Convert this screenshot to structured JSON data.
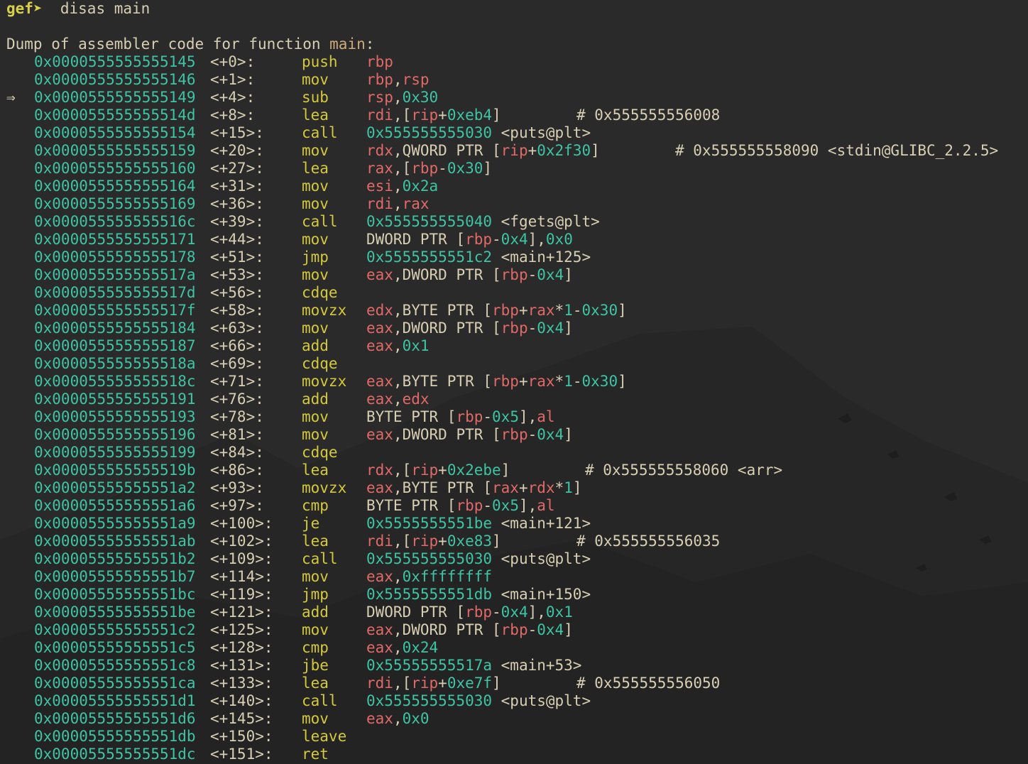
{
  "prompt": {
    "symbol": "gef➤",
    "command": "disas main"
  },
  "dump": {
    "prefix": "Dump of assembler code for function ",
    "function": "main",
    "suffix": ":"
  },
  "current_marker": "⇒",
  "instructions": [
    {
      "addr": "0x0000555555555145",
      "offset": "<+0>:",
      "mnemonic": "push",
      "ops": [
        {
          "t": "rbp",
          "k": "reg"
        }
      ]
    },
    {
      "addr": "0x0000555555555146",
      "offset": "<+1>:",
      "mnemonic": "mov",
      "ops": [
        {
          "t": "rbp",
          "k": "reg"
        },
        {
          "t": ",",
          "k": "txt"
        },
        {
          "t": "rsp",
          "k": "reg"
        }
      ]
    },
    {
      "addr": "0x0000555555555149",
      "offset": "<+4>:",
      "mnemonic": "sub",
      "current": true,
      "ops": [
        {
          "t": "rsp",
          "k": "reg"
        },
        {
          "t": ",",
          "k": "txt"
        },
        {
          "t": "0x30",
          "k": "num"
        }
      ]
    },
    {
      "addr": "0x000055555555514d",
      "offset": "<+8>:",
      "mnemonic": "lea",
      "ops": [
        {
          "t": "rdi",
          "k": "reg"
        },
        {
          "t": ",[",
          "k": "txt"
        },
        {
          "t": "rip",
          "k": "reg"
        },
        {
          "t": "+",
          "k": "txt"
        },
        {
          "t": "0xeb4",
          "k": "num"
        },
        {
          "t": "]",
          "k": "txt"
        }
      ],
      "comment": "# 0x555555556008"
    },
    {
      "addr": "0x0000555555555154",
      "offset": "<+15>:",
      "mnemonic": "call",
      "ops": [
        {
          "t": "0x555555555030",
          "k": "num"
        },
        {
          "t": " <puts@plt>",
          "k": "sym"
        }
      ]
    },
    {
      "addr": "0x0000555555555159",
      "offset": "<+20>:",
      "mnemonic": "mov",
      "ops": [
        {
          "t": "rdx",
          "k": "reg"
        },
        {
          "t": ",QWORD PTR [",
          "k": "txt"
        },
        {
          "t": "rip",
          "k": "reg"
        },
        {
          "t": "+",
          "k": "txt"
        },
        {
          "t": "0x2f30",
          "k": "num"
        },
        {
          "t": "]",
          "k": "txt"
        }
      ],
      "comment": "# 0x555555558090 <stdin@GLIBC_2.2.5>"
    },
    {
      "addr": "0x0000555555555160",
      "offset": "<+27>:",
      "mnemonic": "lea",
      "ops": [
        {
          "t": "rax",
          "k": "reg"
        },
        {
          "t": ",[",
          "k": "txt"
        },
        {
          "t": "rbp",
          "k": "reg"
        },
        {
          "t": "-",
          "k": "txt"
        },
        {
          "t": "0x30",
          "k": "num"
        },
        {
          "t": "]",
          "k": "txt"
        }
      ]
    },
    {
      "addr": "0x0000555555555164",
      "offset": "<+31>:",
      "mnemonic": "mov",
      "ops": [
        {
          "t": "esi",
          "k": "reg"
        },
        {
          "t": ",",
          "k": "txt"
        },
        {
          "t": "0x2a",
          "k": "num"
        }
      ]
    },
    {
      "addr": "0x0000555555555169",
      "offset": "<+36>:",
      "mnemonic": "mov",
      "ops": [
        {
          "t": "rdi",
          "k": "reg"
        },
        {
          "t": ",",
          "k": "txt"
        },
        {
          "t": "rax",
          "k": "reg"
        }
      ]
    },
    {
      "addr": "0x000055555555516c",
      "offset": "<+39>:",
      "mnemonic": "call",
      "ops": [
        {
          "t": "0x555555555040",
          "k": "num"
        },
        {
          "t": " <fgets@plt>",
          "k": "sym"
        }
      ]
    },
    {
      "addr": "0x0000555555555171",
      "offset": "<+44>:",
      "mnemonic": "mov",
      "ops": [
        {
          "t": "DWORD PTR [",
          "k": "txt"
        },
        {
          "t": "rbp",
          "k": "reg"
        },
        {
          "t": "-",
          "k": "txt"
        },
        {
          "t": "0x4",
          "k": "num"
        },
        {
          "t": "],",
          "k": "txt"
        },
        {
          "t": "0x0",
          "k": "num"
        }
      ]
    },
    {
      "addr": "0x0000555555555178",
      "offset": "<+51>:",
      "mnemonic": "jmp",
      "ops": [
        {
          "t": "0x5555555551c2",
          "k": "num"
        },
        {
          "t": " <main+125>",
          "k": "sym"
        }
      ]
    },
    {
      "addr": "0x000055555555517a",
      "offset": "<+53>:",
      "mnemonic": "mov",
      "ops": [
        {
          "t": "eax",
          "k": "reg"
        },
        {
          "t": ",DWORD PTR [",
          "k": "txt"
        },
        {
          "t": "rbp",
          "k": "reg"
        },
        {
          "t": "-",
          "k": "txt"
        },
        {
          "t": "0x4",
          "k": "num"
        },
        {
          "t": "]",
          "k": "txt"
        }
      ]
    },
    {
      "addr": "0x000055555555517d",
      "offset": "<+56>:",
      "mnemonic": "cdqe",
      "ops": []
    },
    {
      "addr": "0x000055555555517f",
      "offset": "<+58>:",
      "mnemonic": "movzx",
      "ops": [
        {
          "t": "edx",
          "k": "reg"
        },
        {
          "t": ",BYTE PTR [",
          "k": "txt"
        },
        {
          "t": "rbp",
          "k": "reg"
        },
        {
          "t": "+",
          "k": "txt"
        },
        {
          "t": "rax",
          "k": "reg"
        },
        {
          "t": "*",
          "k": "txt"
        },
        {
          "t": "1",
          "k": "num"
        },
        {
          "t": "-",
          "k": "txt"
        },
        {
          "t": "0x30",
          "k": "num"
        },
        {
          "t": "]",
          "k": "txt"
        }
      ]
    },
    {
      "addr": "0x0000555555555184",
      "offset": "<+63>:",
      "mnemonic": "mov",
      "ops": [
        {
          "t": "eax",
          "k": "reg"
        },
        {
          "t": ",DWORD PTR [",
          "k": "txt"
        },
        {
          "t": "rbp",
          "k": "reg"
        },
        {
          "t": "-",
          "k": "txt"
        },
        {
          "t": "0x4",
          "k": "num"
        },
        {
          "t": "]",
          "k": "txt"
        }
      ]
    },
    {
      "addr": "0x0000555555555187",
      "offset": "<+66>:",
      "mnemonic": "add",
      "ops": [
        {
          "t": "eax",
          "k": "reg"
        },
        {
          "t": ",",
          "k": "txt"
        },
        {
          "t": "0x1",
          "k": "num"
        }
      ]
    },
    {
      "addr": "0x000055555555518a",
      "offset": "<+69>:",
      "mnemonic": "cdqe",
      "ops": []
    },
    {
      "addr": "0x000055555555518c",
      "offset": "<+71>:",
      "mnemonic": "movzx",
      "ops": [
        {
          "t": "eax",
          "k": "reg"
        },
        {
          "t": ",BYTE PTR [",
          "k": "txt"
        },
        {
          "t": "rbp",
          "k": "reg"
        },
        {
          "t": "+",
          "k": "txt"
        },
        {
          "t": "rax",
          "k": "reg"
        },
        {
          "t": "*",
          "k": "txt"
        },
        {
          "t": "1",
          "k": "num"
        },
        {
          "t": "-",
          "k": "txt"
        },
        {
          "t": "0x30",
          "k": "num"
        },
        {
          "t": "]",
          "k": "txt"
        }
      ]
    },
    {
      "addr": "0x0000555555555191",
      "offset": "<+76>:",
      "mnemonic": "add",
      "ops": [
        {
          "t": "eax",
          "k": "reg"
        },
        {
          "t": ",",
          "k": "txt"
        },
        {
          "t": "edx",
          "k": "reg"
        }
      ]
    },
    {
      "addr": "0x0000555555555193",
      "offset": "<+78>:",
      "mnemonic": "mov",
      "ops": [
        {
          "t": "BYTE PTR [",
          "k": "txt"
        },
        {
          "t": "rbp",
          "k": "reg"
        },
        {
          "t": "-",
          "k": "txt"
        },
        {
          "t": "0x5",
          "k": "num"
        },
        {
          "t": "],",
          "k": "txt"
        },
        {
          "t": "al",
          "k": "reg"
        }
      ]
    },
    {
      "addr": "0x0000555555555196",
      "offset": "<+81>:",
      "mnemonic": "mov",
      "ops": [
        {
          "t": "eax",
          "k": "reg"
        },
        {
          "t": ",DWORD PTR [",
          "k": "txt"
        },
        {
          "t": "rbp",
          "k": "reg"
        },
        {
          "t": "-",
          "k": "txt"
        },
        {
          "t": "0x4",
          "k": "num"
        },
        {
          "t": "]",
          "k": "txt"
        }
      ]
    },
    {
      "addr": "0x0000555555555199",
      "offset": "<+84>:",
      "mnemonic": "cdqe",
      "ops": []
    },
    {
      "addr": "0x000055555555519b",
      "offset": "<+86>:",
      "mnemonic": "lea",
      "ops": [
        {
          "t": "rdx",
          "k": "reg"
        },
        {
          "t": ",[",
          "k": "txt"
        },
        {
          "t": "rip",
          "k": "reg"
        },
        {
          "t": "+",
          "k": "txt"
        },
        {
          "t": "0x2ebe",
          "k": "num"
        },
        {
          "t": "]",
          "k": "txt"
        }
      ],
      "comment": "# 0x555555558060 <arr>"
    },
    {
      "addr": "0x00005555555551a2",
      "offset": "<+93>:",
      "mnemonic": "movzx",
      "ops": [
        {
          "t": "eax",
          "k": "reg"
        },
        {
          "t": ",BYTE PTR [",
          "k": "txt"
        },
        {
          "t": "rax",
          "k": "reg"
        },
        {
          "t": "+",
          "k": "txt"
        },
        {
          "t": "rdx",
          "k": "reg"
        },
        {
          "t": "*",
          "k": "txt"
        },
        {
          "t": "1",
          "k": "num"
        },
        {
          "t": "]",
          "k": "txt"
        }
      ]
    },
    {
      "addr": "0x00005555555551a6",
      "offset": "<+97>:",
      "mnemonic": "cmp",
      "ops": [
        {
          "t": "BYTE PTR [",
          "k": "txt"
        },
        {
          "t": "rbp",
          "k": "reg"
        },
        {
          "t": "-",
          "k": "txt"
        },
        {
          "t": "0x5",
          "k": "num"
        },
        {
          "t": "],",
          "k": "txt"
        },
        {
          "t": "al",
          "k": "reg"
        }
      ]
    },
    {
      "addr": "0x00005555555551a9",
      "offset": "<+100>:",
      "mnemonic": "je",
      "ops": [
        {
          "t": "0x5555555551be",
          "k": "num"
        },
        {
          "t": " <main+121>",
          "k": "sym"
        }
      ]
    },
    {
      "addr": "0x00005555555551ab",
      "offset": "<+102>:",
      "mnemonic": "lea",
      "ops": [
        {
          "t": "rdi",
          "k": "reg"
        },
        {
          "t": ",[",
          "k": "txt"
        },
        {
          "t": "rip",
          "k": "reg"
        },
        {
          "t": "+",
          "k": "txt"
        },
        {
          "t": "0xe83",
          "k": "num"
        },
        {
          "t": "]",
          "k": "txt"
        }
      ],
      "comment": "# 0x555555556035"
    },
    {
      "addr": "0x00005555555551b2",
      "offset": "<+109>:",
      "mnemonic": "call",
      "ops": [
        {
          "t": "0x555555555030",
          "k": "num"
        },
        {
          "t": " <puts@plt>",
          "k": "sym"
        }
      ]
    },
    {
      "addr": "0x00005555555551b7",
      "offset": "<+114>:",
      "mnemonic": "mov",
      "ops": [
        {
          "t": "eax",
          "k": "reg"
        },
        {
          "t": ",",
          "k": "txt"
        },
        {
          "t": "0xffffffff",
          "k": "num"
        }
      ]
    },
    {
      "addr": "0x00005555555551bc",
      "offset": "<+119>:",
      "mnemonic": "jmp",
      "ops": [
        {
          "t": "0x5555555551db",
          "k": "num"
        },
        {
          "t": " <main+150>",
          "k": "sym"
        }
      ]
    },
    {
      "addr": "0x00005555555551be",
      "offset": "<+121>:",
      "mnemonic": "add",
      "ops": [
        {
          "t": "DWORD PTR [",
          "k": "txt"
        },
        {
          "t": "rbp",
          "k": "reg"
        },
        {
          "t": "-",
          "k": "txt"
        },
        {
          "t": "0x4",
          "k": "num"
        },
        {
          "t": "],",
          "k": "txt"
        },
        {
          "t": "0x1",
          "k": "num"
        }
      ]
    },
    {
      "addr": "0x00005555555551c2",
      "offset": "<+125>:",
      "mnemonic": "mov",
      "ops": [
        {
          "t": "eax",
          "k": "reg"
        },
        {
          "t": ",DWORD PTR [",
          "k": "txt"
        },
        {
          "t": "rbp",
          "k": "reg"
        },
        {
          "t": "-",
          "k": "txt"
        },
        {
          "t": "0x4",
          "k": "num"
        },
        {
          "t": "]",
          "k": "txt"
        }
      ]
    },
    {
      "addr": "0x00005555555551c5",
      "offset": "<+128>:",
      "mnemonic": "cmp",
      "ops": [
        {
          "t": "eax",
          "k": "reg"
        },
        {
          "t": ",",
          "k": "txt"
        },
        {
          "t": "0x24",
          "k": "num"
        }
      ]
    },
    {
      "addr": "0x00005555555551c8",
      "offset": "<+131>:",
      "mnemonic": "jbe",
      "ops": [
        {
          "t": "0x55555555517a",
          "k": "num"
        },
        {
          "t": " <main+53>",
          "k": "sym"
        }
      ]
    },
    {
      "addr": "0x00005555555551ca",
      "offset": "<+133>:",
      "mnemonic": "lea",
      "ops": [
        {
          "t": "rdi",
          "k": "reg"
        },
        {
          "t": ",[",
          "k": "txt"
        },
        {
          "t": "rip",
          "k": "reg"
        },
        {
          "t": "+",
          "k": "txt"
        },
        {
          "t": "0xe7f",
          "k": "num"
        },
        {
          "t": "]",
          "k": "txt"
        }
      ],
      "comment": "# 0x555555556050"
    },
    {
      "addr": "0x00005555555551d1",
      "offset": "<+140>:",
      "mnemonic": "call",
      "ops": [
        {
          "t": "0x555555555030",
          "k": "num"
        },
        {
          "t": " <puts@plt>",
          "k": "sym"
        }
      ]
    },
    {
      "addr": "0x00005555555551d6",
      "offset": "<+145>:",
      "mnemonic": "mov",
      "ops": [
        {
          "t": "eax",
          "k": "reg"
        },
        {
          "t": ",",
          "k": "txt"
        },
        {
          "t": "0x0",
          "k": "num"
        }
      ]
    },
    {
      "addr": "0x00005555555551db",
      "offset": "<+150>:",
      "mnemonic": "leave",
      "ops": []
    },
    {
      "addr": "0x00005555555551dc",
      "offset": "<+151>:",
      "mnemonic": "ret",
      "ops": []
    }
  ],
  "colors": {
    "background": "#2a2a2a",
    "address": "#3ec4a4",
    "register": "#e06a67",
    "number": "#3ec4a4",
    "mnemonic": "#d4c93c",
    "text": "#d8cfb2",
    "function_name": "#cdaa79",
    "prompt": "#d8cf4a"
  }
}
